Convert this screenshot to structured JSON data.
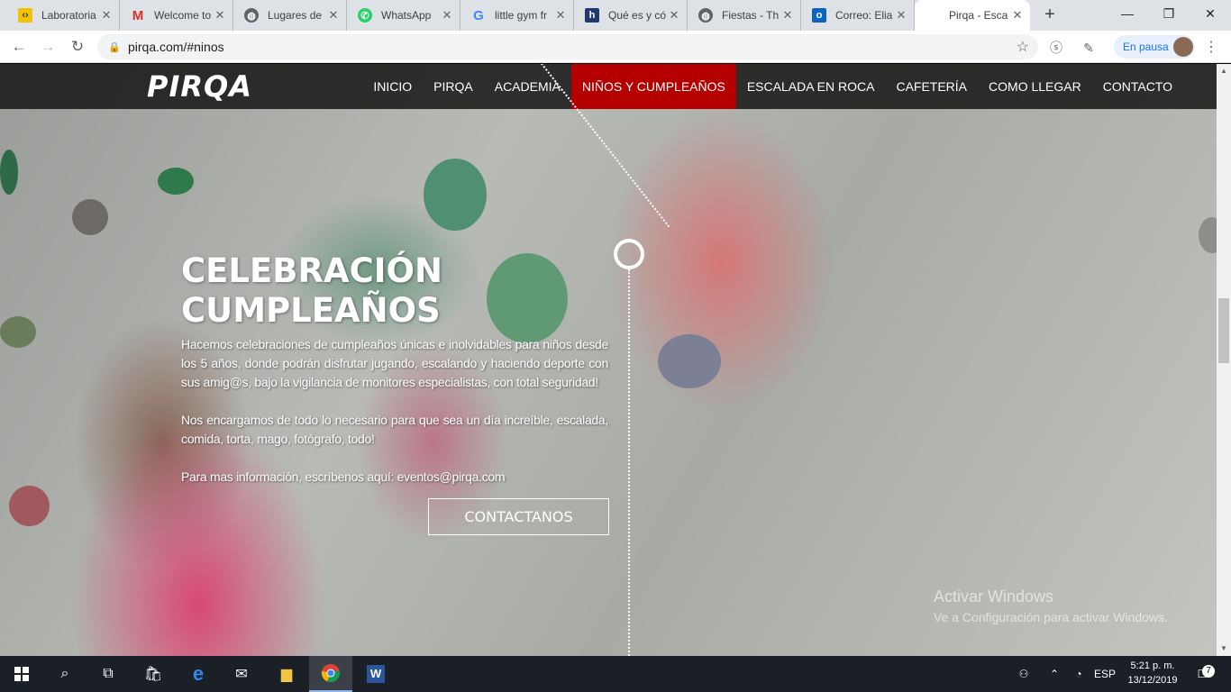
{
  "browser": {
    "tabs": [
      {
        "label": "Laboratoria",
        "icon": "laboratoria-icon",
        "color": "#f2c200"
      },
      {
        "label": "Welcome to",
        "icon": "gmail-icon",
        "color": "#d93025"
      },
      {
        "label": "Lugares de",
        "icon": "globe-icon",
        "color": "#5f6368"
      },
      {
        "label": "WhatsApp",
        "icon": "whatsapp-icon",
        "color": "#25d366"
      },
      {
        "label": "little gym fr",
        "icon": "google-icon",
        "color": "#4285f4"
      },
      {
        "label": "Qué es y có",
        "icon": "h-icon",
        "color": "#1f3a6e"
      },
      {
        "label": "Fiestas - Th",
        "icon": "globe-icon",
        "color": "#5f6368"
      },
      {
        "label": "Correo: Elia",
        "icon": "outlook-icon",
        "color": "#0a64c2"
      },
      {
        "label": "Pirqa - Esca",
        "icon": "page-icon",
        "color": "#ffffff"
      }
    ],
    "url": "pirqa.com/#ninos",
    "profile_label": "En pausa"
  },
  "site": {
    "logo": "PIRQA",
    "nav": [
      "INICIO",
      "PIRQA",
      "ACADEMIA",
      "NIÑOS Y CUMPLEAÑOS",
      "ESCALADA EN ROCA",
      "CAFETERÍA",
      "COMO LLEGAR",
      "CONTACTO"
    ],
    "active_nav": "NIÑOS Y CUMPLEAÑOS",
    "accent": "#b50000",
    "hero": {
      "title_line1": "CELEBRACIÓN",
      "title_line2": "CUMPLEAÑOS",
      "paragraph1": "Hacemos celebraciones de cumpleaños únicas e inolvidables para niños desde los 5 años, donde podrán disfrutar jugando, escalando  y haciendo deporte con sus amig@s, bajo la vigilancia de monitores especialistas, con total seguridad!",
      "paragraph2": "Nos encargamos de todo lo necesario para que sea un día increíble, escalada, comida, torta, mago, fotógrafo, todo!",
      "paragraph3": "Para mas información, escríbenos aquí: eventos@pirqa.com",
      "cta": "CONTACTANOS"
    }
  },
  "watermark": {
    "line1": "Activar Windows",
    "line2": "Ve a Configuración para activar Windows."
  },
  "taskbar": {
    "lang": "ESP",
    "time": "5:21 p. m.",
    "date": "13/12/2019",
    "notifications": "7"
  }
}
